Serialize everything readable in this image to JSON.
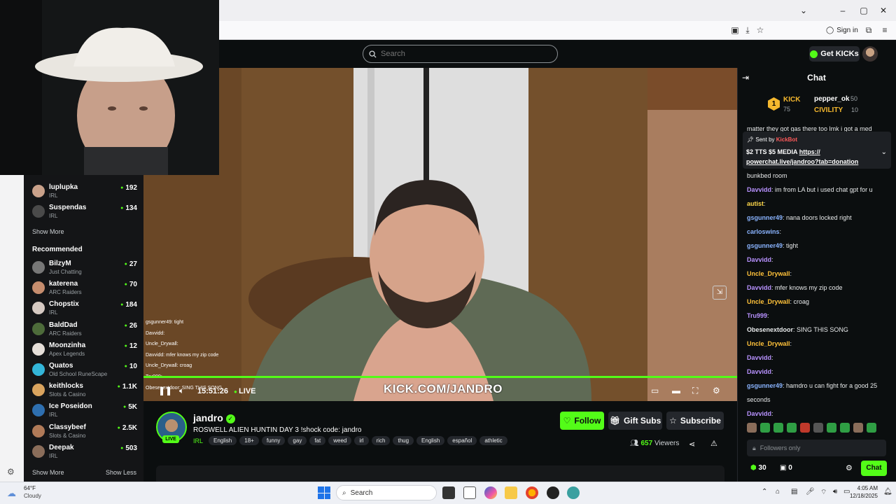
{
  "browser": {
    "sign_in": "Sign in"
  },
  "header": {
    "search_placeholder": "Search",
    "get_kicks": "Get KICKs"
  },
  "sidebar": {
    "following": [
      {
        "name": "luplupka",
        "category": "IRL",
        "viewers": "192",
        "color": "#c9a18a"
      },
      {
        "name": "Suspendas",
        "category": "IRL",
        "viewers": "134",
        "color": "#4a4a4a"
      }
    ],
    "show_more": "Show More",
    "recommended_title": "Recommended",
    "recommended": [
      {
        "name": "BilzyM",
        "category": "Just Chatting",
        "viewers": "27",
        "color": "#777"
      },
      {
        "name": "katerena",
        "category": "ARC Raiders",
        "viewers": "70",
        "color": "#c68d6e"
      },
      {
        "name": "Chopstix",
        "category": "IRL",
        "viewers": "184",
        "color": "#d5c9c2"
      },
      {
        "name": "BaldDad",
        "category": "ARC Raiders",
        "viewers": "26",
        "color": "#4d6b3a"
      },
      {
        "name": "Moonzinha",
        "category": "Apex Legends",
        "viewers": "12",
        "color": "#e6dfd9"
      },
      {
        "name": "Quatos",
        "category": "Old School RuneScape",
        "viewers": "10",
        "color": "#33b5d8"
      },
      {
        "name": "keithlocks",
        "category": "Slots & Casino",
        "viewers": "1.1K",
        "color": "#d9a35e"
      },
      {
        "name": "Ice Poseidon",
        "category": "IRL",
        "viewers": "5K",
        "color": "#2e6fb0"
      },
      {
        "name": "Classybeef",
        "category": "Slots & Casino",
        "viewers": "2.5K",
        "color": "#b07a58"
      },
      {
        "name": "Deepak",
        "category": "IRL",
        "viewers": "503",
        "color": "#8a6d5a"
      }
    ],
    "show_more_bottom": "Show More",
    "show_less": "Show Less"
  },
  "player": {
    "elapsed": "15:51:26",
    "live": "LIVE",
    "watermark": "KICK.COM/JANDRO",
    "progress_fraction": 1.0,
    "overlay_chat": [
      "gsgunner49: tight",
      "Davvidd:",
      "Uncle_Drywall:",
      "Davvidd: mfer knows my zip code",
      "Uncle_Drywall: croag",
      "Tru999:",
      "Obesenextdoor: SING THIS SONG"
    ]
  },
  "stream": {
    "streamer": "jandro",
    "live_badge": "LIVE",
    "title": "ROSWELL ALIEN HUNTIN DAY 3 !shock code: jandro",
    "category": "IRL",
    "tags": [
      "English",
      "18+",
      "funny",
      "gay",
      "fat",
      "weed",
      "irl",
      "rich",
      "thug",
      "English",
      "español",
      "athletic"
    ],
    "follow": "Follow",
    "gift_subs": "Gift Subs",
    "subscribe": "Subscribe",
    "viewers_count": "657",
    "viewers_label": "Viewers"
  },
  "chat": {
    "title": "Chat",
    "leaderboard": {
      "rank": "1",
      "first_name": "KICK",
      "first_score": "75",
      "second_name": "pepper_ok",
      "second_score": "50",
      "third_name": "CIVILITY",
      "third_score": "10"
    },
    "scroll_top_text": "matter they got gas there too lmk i got a med",
    "pinned": {
      "sent_by": "Sent by",
      "bot": "KickBot",
      "text": "$2 TTS $5 MEDIA",
      "link_line1": "https://",
      "link_line2": "powerchat.live/jandroo?tab=donation"
    },
    "messages": [
      {
        "user": "",
        "text": "bunkbed room",
        "color": "#e8eaeb"
      },
      {
        "user": "Davvidd",
        "text": "im from LA but i used chat gpt for u",
        "color": "#b892ff"
      },
      {
        "user": "autist",
        "text": "",
        "color": "#ffd84a"
      },
      {
        "user": "gsgunner49",
        "text": "nana doors locked right",
        "color": "#8ab4ff"
      },
      {
        "user": "carloswins",
        "text": "",
        "color": "#8ab4ff"
      },
      {
        "user": "gsgunner49",
        "text": "tight",
        "color": "#8ab4ff"
      },
      {
        "user": "Davvidd",
        "text": "",
        "color": "#b892ff"
      },
      {
        "user": "Uncle_Drywall",
        "text": "",
        "color": "#ffc23a"
      },
      {
        "user": "Davvidd",
        "text": "mfer knows my zip code",
        "color": "#b892ff"
      },
      {
        "user": "Uncle_Drywall",
        "text": "croag",
        "color": "#ffc23a"
      },
      {
        "user": "Tru999",
        "text": "",
        "color": "#b892ff"
      },
      {
        "user": "Obesenextdoor",
        "text": "SING THIS SONG",
        "color": "#e8eaeb"
      },
      {
        "user": "Uncle_Drywall",
        "text": "",
        "color": "#ffc23a"
      },
      {
        "user": "Davvidd",
        "text": "",
        "color": "#b892ff"
      },
      {
        "user": "Davvidd",
        "text": "",
        "color": "#b892ff"
      },
      {
        "user": "gsgunner49",
        "text": "hamdro u can fight for a good 25",
        "color": "#8ab4ff"
      },
      {
        "user": "",
        "text": "seconds",
        "color": "#e8eaeb"
      },
      {
        "user": "Davvidd",
        "text": "",
        "color": "#b892ff"
      }
    ],
    "followers_only": "Followers only",
    "kicks_balance": "30",
    "gifts_count": "0",
    "send": "Chat"
  },
  "taskbar": {
    "temp": "64°F",
    "weather": "Cloudy",
    "search": "Search",
    "time": "4:05 AM",
    "date": "12/18/2025"
  },
  "colors": {
    "accent": "#53fc18",
    "bg": "#0b0e0f"
  }
}
